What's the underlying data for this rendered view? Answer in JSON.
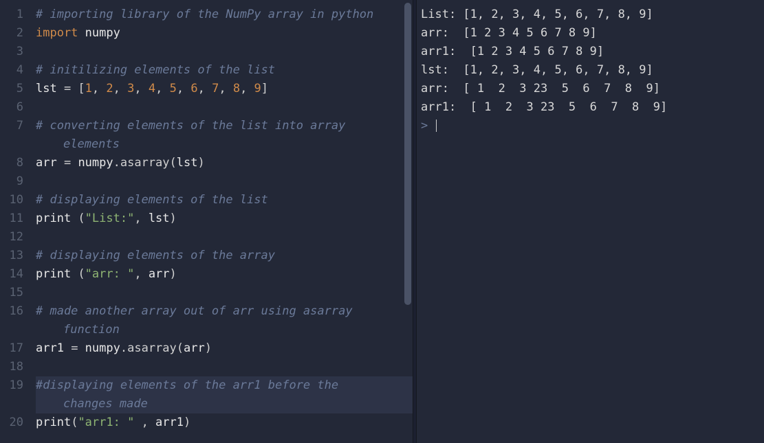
{
  "editor": {
    "lines": [
      {
        "n": "1",
        "tokens": [
          {
            "t": "# importing library of the NumPy array in python",
            "c": "comment"
          }
        ]
      },
      {
        "n": "2",
        "tokens": [
          {
            "t": "import",
            "c": "kw"
          },
          {
            "t": " ",
            "c": "op"
          },
          {
            "t": "numpy",
            "c": "name"
          }
        ]
      },
      {
        "n": "3",
        "tokens": []
      },
      {
        "n": "4",
        "tokens": [
          {
            "t": "# initilizing elements of the list",
            "c": "comment"
          }
        ]
      },
      {
        "n": "5",
        "tokens": [
          {
            "t": "lst",
            "c": "name"
          },
          {
            "t": " = [",
            "c": "op"
          },
          {
            "t": "1",
            "c": "num"
          },
          {
            "t": ", ",
            "c": "op"
          },
          {
            "t": "2",
            "c": "num"
          },
          {
            "t": ", ",
            "c": "op"
          },
          {
            "t": "3",
            "c": "num"
          },
          {
            "t": ", ",
            "c": "op"
          },
          {
            "t": "4",
            "c": "num"
          },
          {
            "t": ", ",
            "c": "op"
          },
          {
            "t": "5",
            "c": "num"
          },
          {
            "t": ", ",
            "c": "op"
          },
          {
            "t": "6",
            "c": "num"
          },
          {
            "t": ", ",
            "c": "op"
          },
          {
            "t": "7",
            "c": "num"
          },
          {
            "t": ", ",
            "c": "op"
          },
          {
            "t": "8",
            "c": "num"
          },
          {
            "t": ", ",
            "c": "op"
          },
          {
            "t": "9",
            "c": "num"
          },
          {
            "t": "]",
            "c": "op"
          }
        ]
      },
      {
        "n": "6",
        "tokens": []
      },
      {
        "n": "7",
        "tokens": [
          {
            "t": "# converting elements of the list into array ",
            "c": "comment"
          }
        ]
      },
      {
        "n": "",
        "wrap": true,
        "tokens": [
          {
            "t": "elements",
            "c": "comment"
          }
        ]
      },
      {
        "n": "8",
        "tokens": [
          {
            "t": "arr",
            "c": "name"
          },
          {
            "t": " = ",
            "c": "op"
          },
          {
            "t": "numpy",
            "c": "name"
          },
          {
            "t": ".",
            "c": "op"
          },
          {
            "t": "asarray",
            "c": "func"
          },
          {
            "t": "(",
            "c": "op"
          },
          {
            "t": "lst",
            "c": "name"
          },
          {
            "t": ")",
            "c": "op"
          }
        ]
      },
      {
        "n": "9",
        "tokens": []
      },
      {
        "n": "10",
        "tokens": [
          {
            "t": "# displaying elements of the list",
            "c": "comment"
          }
        ]
      },
      {
        "n": "11",
        "tokens": [
          {
            "t": "print",
            "c": "name"
          },
          {
            "t": " (",
            "c": "op"
          },
          {
            "t": "\"List:\"",
            "c": "str"
          },
          {
            "t": ", ",
            "c": "op"
          },
          {
            "t": "lst",
            "c": "name"
          },
          {
            "t": ")",
            "c": "op"
          }
        ]
      },
      {
        "n": "12",
        "tokens": []
      },
      {
        "n": "13",
        "tokens": [
          {
            "t": "# displaying elements of the array",
            "c": "comment"
          }
        ]
      },
      {
        "n": "14",
        "tokens": [
          {
            "t": "print",
            "c": "name"
          },
          {
            "t": " (",
            "c": "op"
          },
          {
            "t": "\"arr: \"",
            "c": "str"
          },
          {
            "t": ", ",
            "c": "op"
          },
          {
            "t": "arr",
            "c": "name"
          },
          {
            "t": ")",
            "c": "op"
          }
        ]
      },
      {
        "n": "15",
        "tokens": []
      },
      {
        "n": "16",
        "tokens": [
          {
            "t": "# made another array out of arr using asarray ",
            "c": "comment"
          }
        ]
      },
      {
        "n": "",
        "wrap": true,
        "tokens": [
          {
            "t": "function",
            "c": "comment"
          }
        ]
      },
      {
        "n": "17",
        "tokens": [
          {
            "t": "arr1",
            "c": "name"
          },
          {
            "t": " = ",
            "c": "op"
          },
          {
            "t": "numpy",
            "c": "name"
          },
          {
            "t": ".",
            "c": "op"
          },
          {
            "t": "asarray",
            "c": "func"
          },
          {
            "t": "(",
            "c": "op"
          },
          {
            "t": "arr",
            "c": "name"
          },
          {
            "t": ")",
            "c": "op"
          }
        ]
      },
      {
        "n": "18",
        "tokens": []
      },
      {
        "n": "19",
        "sel": true,
        "tokens": [
          {
            "t": "#displaying elements of the arr1 before the ",
            "c": "comment"
          }
        ]
      },
      {
        "n": "",
        "wrap": true,
        "sel": true,
        "tokens": [
          {
            "t": "changes made",
            "c": "comment"
          }
        ]
      },
      {
        "n": "20",
        "tokens": [
          {
            "t": "print",
            "c": "name"
          },
          {
            "t": "(",
            "c": "op"
          },
          {
            "t": "\"arr1: \"",
            "c": "str"
          },
          {
            "t": " , ",
            "c": "op"
          },
          {
            "t": "arr1",
            "c": "name"
          },
          {
            "t": ")",
            "c": "op"
          }
        ]
      }
    ]
  },
  "output": {
    "lines": [
      "List: [1, 2, 3, 4, 5, 6, 7, 8, 9]",
      "arr:  [1 2 3 4 5 6 7 8 9]",
      "arr1:  [1 2 3 4 5 6 7 8 9]",
      "lst:  [1, 2, 3, 4, 5, 6, 7, 8, 9]",
      "arr:  [ 1  2  3 23  5  6  7  8  9]",
      "arr1:  [ 1  2  3 23  5  6  7  8  9]"
    ],
    "prompt": ">"
  }
}
